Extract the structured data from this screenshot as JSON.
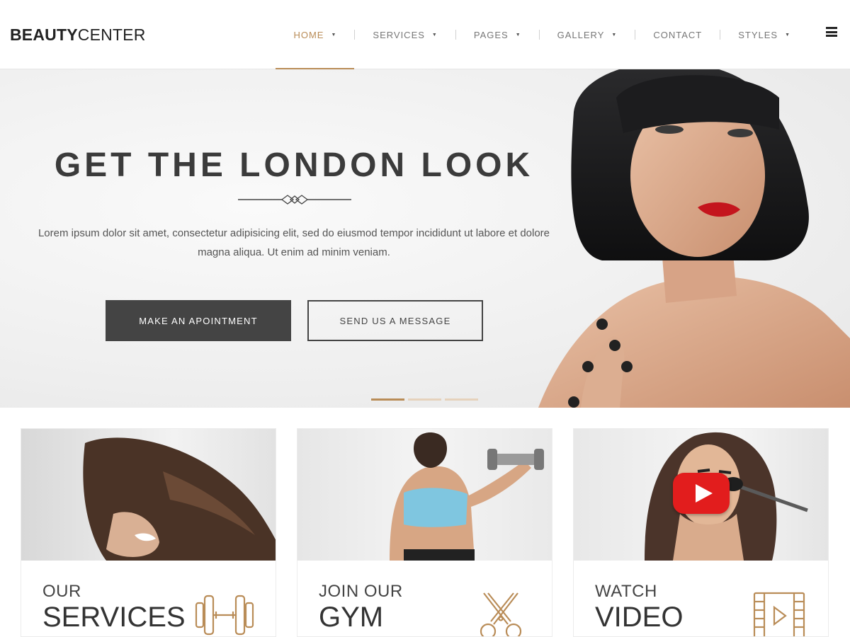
{
  "brand": {
    "bold": "BEAUTY",
    "light": "CENTER"
  },
  "nav": {
    "items": [
      {
        "label": "HOME",
        "dropdown": true,
        "active": true
      },
      {
        "label": "SERVICES",
        "dropdown": true
      },
      {
        "label": "PAGES",
        "dropdown": true
      },
      {
        "label": "GALLERY",
        "dropdown": true
      },
      {
        "label": "CONTACT",
        "dropdown": false
      },
      {
        "label": "STYLES",
        "dropdown": true
      }
    ],
    "caret": "▼",
    "menu_icon": "hamburger-menu-icon"
  },
  "hero": {
    "title": "GET THE LONDON LOOK",
    "text": "Lorem ipsum dolor sit amet, consectetur adipisicing elit, sed do eiusmod tempor incididunt ut labore et dolore magna aliqua. Ut enim ad minim veniam.",
    "primary_button": "MAKE AN APOINTMENT",
    "secondary_button": "SEND US A MESSAGE",
    "slides": 3,
    "active_slide": 1
  },
  "cards": [
    {
      "small": "OUR",
      "big": "SERVICES",
      "icon": "dumbbell-icon"
    },
    {
      "small": "JOIN OUR",
      "big": "GYM",
      "icon": "scissors-icon"
    },
    {
      "small": "WATCH",
      "big": "VIDEO",
      "icon": "film-play-icon"
    }
  ],
  "colors": {
    "accent": "#b98c57",
    "dark": "#444444",
    "text": "#333333",
    "muted": "#777777"
  }
}
